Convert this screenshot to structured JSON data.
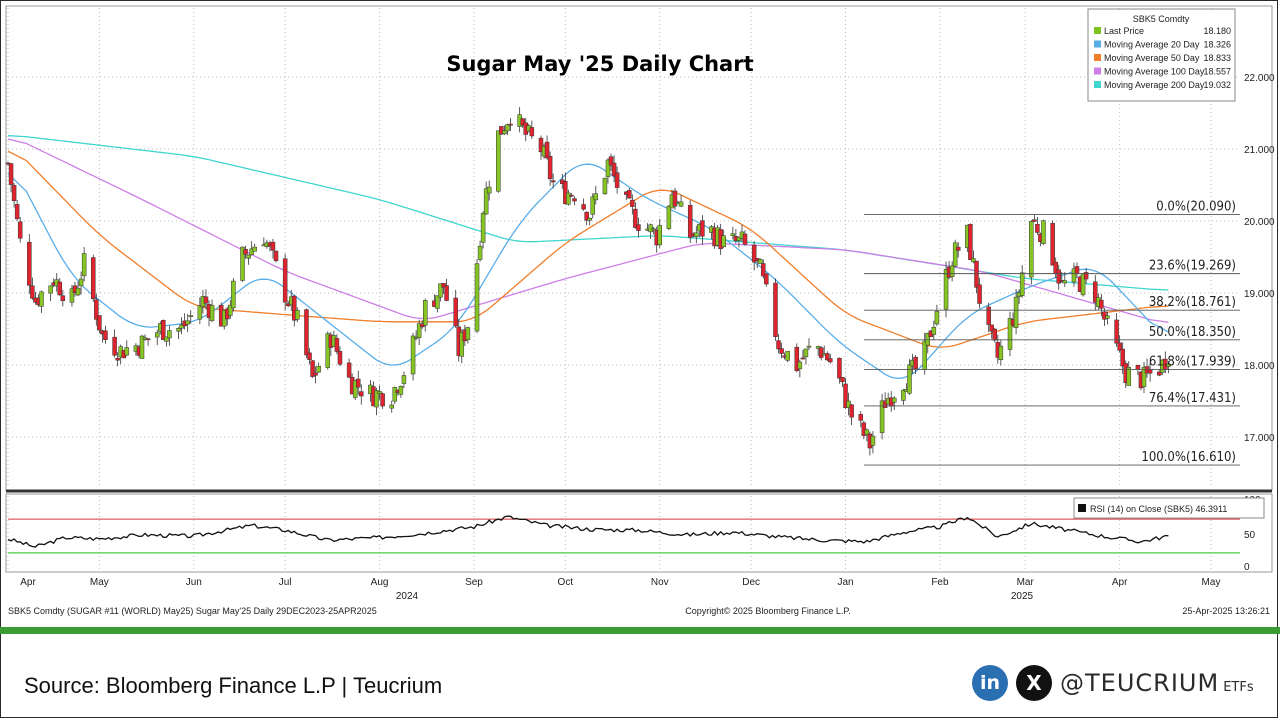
{
  "chart_data": {
    "type": "candlestick",
    "title": "Sugar May '25 Daily Chart",
    "price_axis": {
      "ticks": [
        "22.000",
        "21.000",
        "20.000",
        "19.000",
        "18.000",
        "17.000"
      ],
      "ylim": [
        16.4,
        22.6
      ]
    },
    "rsi_axis": {
      "ticks": [
        "100",
        "50",
        "0"
      ],
      "overbought": 70,
      "oversold": 30
    },
    "x_axis": {
      "months": [
        "Apr",
        "May",
        "Jun",
        "Jul",
        "Aug",
        "Sep",
        "Oct",
        "Nov",
        "Dec",
        "Jan",
        "Feb",
        "Mar",
        "Apr",
        "May"
      ],
      "years": [
        "2024",
        "2025"
      ]
    },
    "legend": {
      "header": "SBK5 Comdty",
      "items": [
        {
          "label": "Last Price",
          "value": "18.180",
          "color": "#7cc520"
        },
        {
          "label": "Moving Average 20 Day",
          "value": "18.326",
          "color": "#5aaee8"
        },
        {
          "label": "Moving Average 50 Day",
          "value": "18.833",
          "color": "#f07e2a"
        },
        {
          "label": "Moving Average 100 Day",
          "value": "18.557",
          "color": "#cd7fe6"
        },
        {
          "label": "Moving Average 200 Day",
          "value": "19.032",
          "color": "#3fd6d0"
        }
      ]
    },
    "rsi_legend": "RSI (14)  on Close (SBK5) 46.3911",
    "fibonacci": [
      {
        "label": "0.0%(20.090)",
        "value": 20.09
      },
      {
        "label": "23.6%(19.269)",
        "value": 19.269
      },
      {
        "label": "38.2%(18.761)",
        "value": 18.761
      },
      {
        "label": "50.0%(18.350)",
        "value": 18.35
      },
      {
        "label": "61.8%(17.939)",
        "value": 17.939
      },
      {
        "label": "76.4%(17.431)",
        "value": 17.431
      },
      {
        "label": "100.0%(16.610)",
        "value": 16.61
      }
    ],
    "price_anchors": [
      [
        "2024-04-01",
        20.8
      ],
      [
        "2024-04-05",
        19.7
      ],
      [
        "2024-04-10",
        18.9
      ],
      [
        "2024-04-16",
        19.2
      ],
      [
        "2024-04-22",
        18.9
      ],
      [
        "2024-04-26",
        19.4
      ],
      [
        "2024-05-02",
        18.4
      ],
      [
        "2024-05-08",
        18.2
      ],
      [
        "2024-05-15",
        18.3
      ],
      [
        "2024-05-21",
        18.5
      ],
      [
        "2024-05-28",
        18.5
      ],
      [
        "2024-06-04",
        18.9
      ],
      [
        "2024-06-11",
        18.6
      ],
      [
        "2024-06-17",
        19.5
      ],
      [
        "2024-06-24",
        19.8
      ],
      [
        "2024-07-01",
        19.0
      ],
      [
        "2024-07-05",
        18.6
      ],
      [
        "2024-07-10",
        17.8
      ],
      [
        "2024-07-16",
        18.4
      ],
      [
        "2024-07-22",
        17.8
      ],
      [
        "2024-07-29",
        17.6
      ],
      [
        "2024-08-05",
        17.6
      ],
      [
        "2024-08-10",
        18.0
      ],
      [
        "2024-08-16",
        18.8
      ],
      [
        "2024-08-22",
        19.1
      ],
      [
        "2024-08-27",
        18.2
      ],
      [
        "2024-08-31",
        18.7
      ],
      [
        "2024-09-04",
        20.2
      ],
      [
        "2024-09-09",
        21.2
      ],
      [
        "2024-09-13",
        21.5
      ],
      [
        "2024-09-18",
        21.2
      ],
      [
        "2024-09-23",
        21.0
      ],
      [
        "2024-09-28",
        20.4
      ],
      [
        "2024-10-04",
        20.4
      ],
      [
        "2024-10-09",
        20.1
      ],
      [
        "2024-10-15",
        20.8
      ],
      [
        "2024-10-21",
        20.2
      ],
      [
        "2024-10-25",
        20.0
      ],
      [
        "2024-10-31",
        19.8
      ],
      [
        "2024-11-05",
        20.4
      ],
      [
        "2024-11-11",
        19.8
      ],
      [
        "2024-11-17",
        19.9
      ],
      [
        "2024-11-22",
        19.7
      ],
      [
        "2024-11-28",
        19.7
      ],
      [
        "2024-12-04",
        19.3
      ],
      [
        "2024-12-10",
        18.3
      ],
      [
        "2024-12-16",
        18.0
      ],
      [
        "2024-12-22",
        18.3
      ],
      [
        "2024-12-28",
        18.0
      ],
      [
        "2025-01-03",
        17.3
      ],
      [
        "2025-01-09",
        16.9
      ],
      [
        "2025-01-14",
        17.5
      ],
      [
        "2025-01-20",
        17.8
      ],
      [
        "2025-01-26",
        18.0
      ],
      [
        "2025-01-31",
        18.8
      ],
      [
        "2025-02-05",
        19.5
      ],
      [
        "2025-02-10",
        19.8
      ],
      [
        "2025-02-16",
        18.5
      ],
      [
        "2025-02-20",
        18.1
      ],
      [
        "2025-02-26",
        18.8
      ],
      [
        "2025-03-03",
        20.0
      ],
      [
        "2025-03-08",
        19.8
      ],
      [
        "2025-03-13",
        19.1
      ],
      [
        "2025-03-18",
        19.2
      ],
      [
        "2025-03-24",
        19.0
      ],
      [
        "2025-03-29",
        18.4
      ],
      [
        "2025-04-03",
        17.9
      ],
      [
        "2025-04-09",
        17.8
      ],
      [
        "2025-04-15",
        18.0
      ],
      [
        "2025-04-17",
        18.18
      ]
    ],
    "moving_averages": {
      "ma20": [
        [
          "2024-04-01",
          20.9
        ],
        [
          "2024-04-22",
          19.2
        ],
        [
          "2024-05-13",
          18.5
        ],
        [
          "2024-06-03",
          18.6
        ],
        [
          "2024-06-24",
          19.3
        ],
        [
          "2024-07-15",
          18.6
        ],
        [
          "2024-08-05",
          17.9
        ],
        [
          "2024-08-26",
          18.5
        ],
        [
          "2024-09-16",
          20.0
        ],
        [
          "2024-10-07",
          20.9
        ],
        [
          "2024-10-28",
          20.3
        ],
        [
          "2024-11-18",
          19.9
        ],
        [
          "2024-12-09",
          19.2
        ],
        [
          "2024-12-30",
          18.3
        ],
        [
          "2025-01-20",
          17.7
        ],
        [
          "2025-02-10",
          18.7
        ],
        [
          "2025-03-03",
          19.1
        ],
        [
          "2025-03-24",
          19.4
        ],
        [
          "2025-04-17",
          18.326
        ]
      ],
      "ma50": [
        [
          "2024-04-01",
          21.1
        ],
        [
          "2024-05-01",
          19.8
        ],
        [
          "2024-06-01",
          18.8
        ],
        [
          "2024-07-01",
          18.7
        ],
        [
          "2024-08-01",
          18.6
        ],
        [
          "2024-09-01",
          18.6
        ],
        [
          "2024-10-01",
          19.7
        ],
        [
          "2024-11-01",
          20.5
        ],
        [
          "2024-12-01",
          19.9
        ],
        [
          "2025-01-01",
          18.7
        ],
        [
          "2025-02-01",
          18.2
        ],
        [
          "2025-03-01",
          18.6
        ],
        [
          "2025-04-17",
          18.833
        ]
      ],
      "ma100": [
        [
          "2024-04-01",
          21.2
        ],
        [
          "2024-05-15",
          20.3
        ],
        [
          "2024-07-01",
          19.3
        ],
        [
          "2024-08-15",
          18.6
        ],
        [
          "2024-10-01",
          19.2
        ],
        [
          "2024-11-15",
          19.7
        ],
        [
          "2025-01-01",
          19.6
        ],
        [
          "2025-02-15",
          19.3
        ],
        [
          "2025-04-17",
          18.557
        ]
      ],
      "ma200": [
        [
          "2024-04-01",
          21.2
        ],
        [
          "2024-06-01",
          20.9
        ],
        [
          "2024-08-01",
          20.3
        ],
        [
          "2024-09-15",
          19.7
        ],
        [
          "2024-11-01",
          19.8
        ],
        [
          "2025-01-01",
          19.6
        ],
        [
          "2025-03-01",
          19.2
        ],
        [
          "2025-04-17",
          19.032
        ]
      ]
    },
    "rsi_anchors": [
      [
        "2024-04-01",
        42
      ],
      [
        "2024-04-10",
        30
      ],
      [
        "2024-04-20",
        44
      ],
      [
        "2024-05-01",
        42
      ],
      [
        "2024-05-15",
        48
      ],
      [
        "2024-06-01",
        46
      ],
      [
        "2024-06-20",
        62
      ],
      [
        "2024-07-01",
        55
      ],
      [
        "2024-07-15",
        40
      ],
      [
        "2024-08-01",
        44
      ],
      [
        "2024-08-15",
        50
      ],
      [
        "2024-09-01",
        60
      ],
      [
        "2024-09-12",
        75
      ],
      [
        "2024-09-25",
        62
      ],
      [
        "2024-10-10",
        56
      ],
      [
        "2024-10-25",
        55
      ],
      [
        "2024-11-10",
        48
      ],
      [
        "2024-11-25",
        52
      ],
      [
        "2024-12-10",
        45
      ],
      [
        "2024-12-25",
        40
      ],
      [
        "2025-01-08",
        38
      ],
      [
        "2025-01-20",
        52
      ],
      [
        "2025-02-01",
        60
      ],
      [
        "2025-02-10",
        75
      ],
      [
        "2025-02-20",
        45
      ],
      [
        "2025-03-03",
        65
      ],
      [
        "2025-03-15",
        55
      ],
      [
        "2025-03-28",
        45
      ],
      [
        "2025-04-08",
        38
      ],
      [
        "2025-04-17",
        46.39
      ]
    ]
  },
  "footer_line": {
    "left": "SBK5 Comdty (SUGAR #11 (WORLD) May25) Sugar May'25  Daily 29DEC2023-25APR2025",
    "center": "Copyright© 2025 Bloomberg Finance L.P.",
    "right": "25-Apr-2025 13:26:21"
  },
  "source_text": "Source: Bloomberg Finance L.P | Teucrium",
  "social": {
    "linkedin_glyph": "in",
    "x_glyph": "X",
    "handle": "@TEUCRIUM",
    "handle_suffix": "ETFs"
  }
}
